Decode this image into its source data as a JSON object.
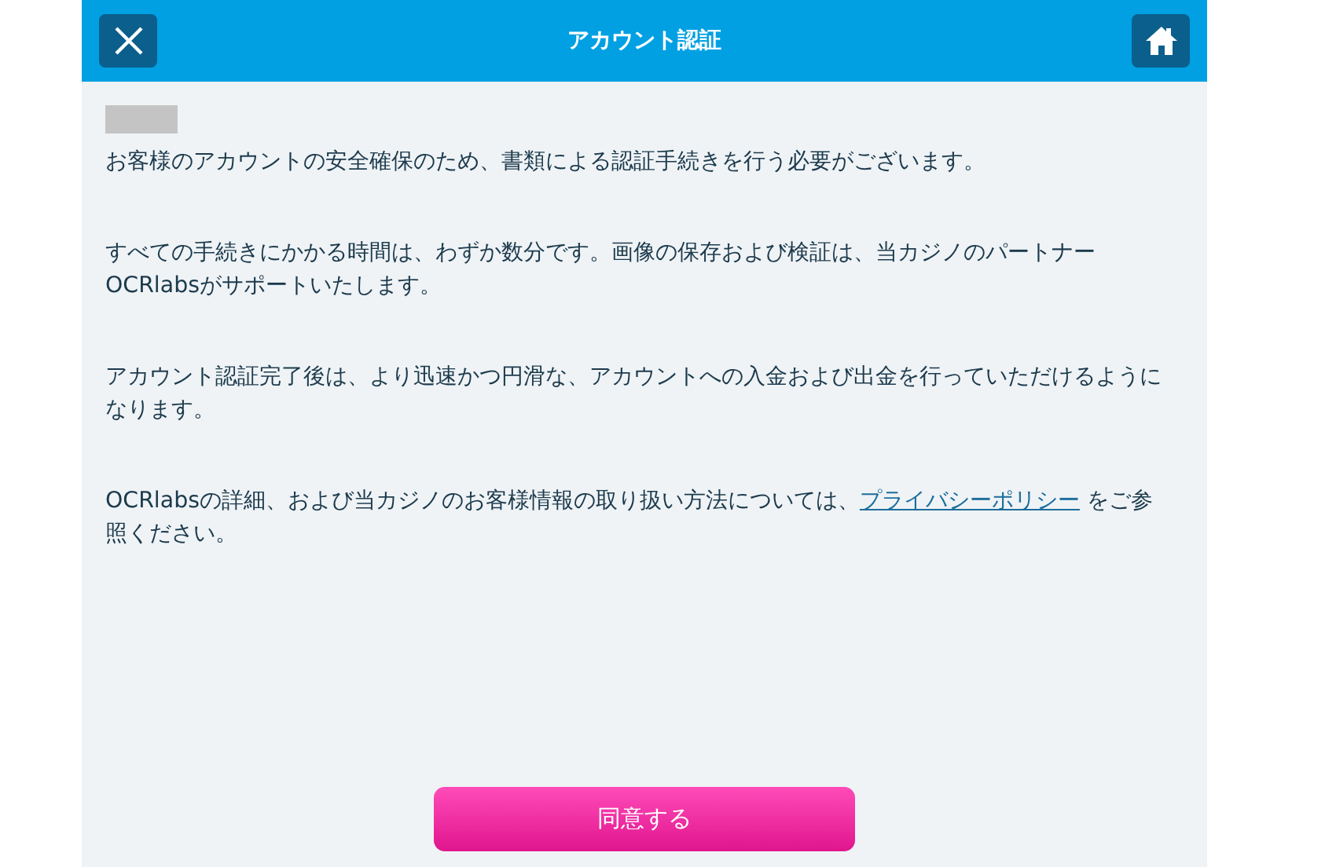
{
  "header": {
    "title": "アカウント認証"
  },
  "paragraphs": [
    {
      "kind": "plain",
      "text": "お客様のアカウントの安全確保のため、書類による認証手続きを行う必要がございます。"
    },
    {
      "kind": "plain",
      "text": "すべての手続きにかかる時間は、わずか数分です。画像の保存および検証は、当カジノのパートナーOCRlabsがサポートいたします。"
    },
    {
      "kind": "plain",
      "text": "アカウント認証完了後は、より迅速かつ円滑な、アカウントへの入金および出金を行っていただけるようになります。"
    },
    {
      "kind": "link",
      "text": "OCRlabsの詳細、および当カジノのお客様情報の取り扱い方法については、",
      "link": "プライバシーポリシー",
      "after": " をご参照ください。"
    }
  ],
  "agree_button": {
    "label": "同意する"
  }
}
